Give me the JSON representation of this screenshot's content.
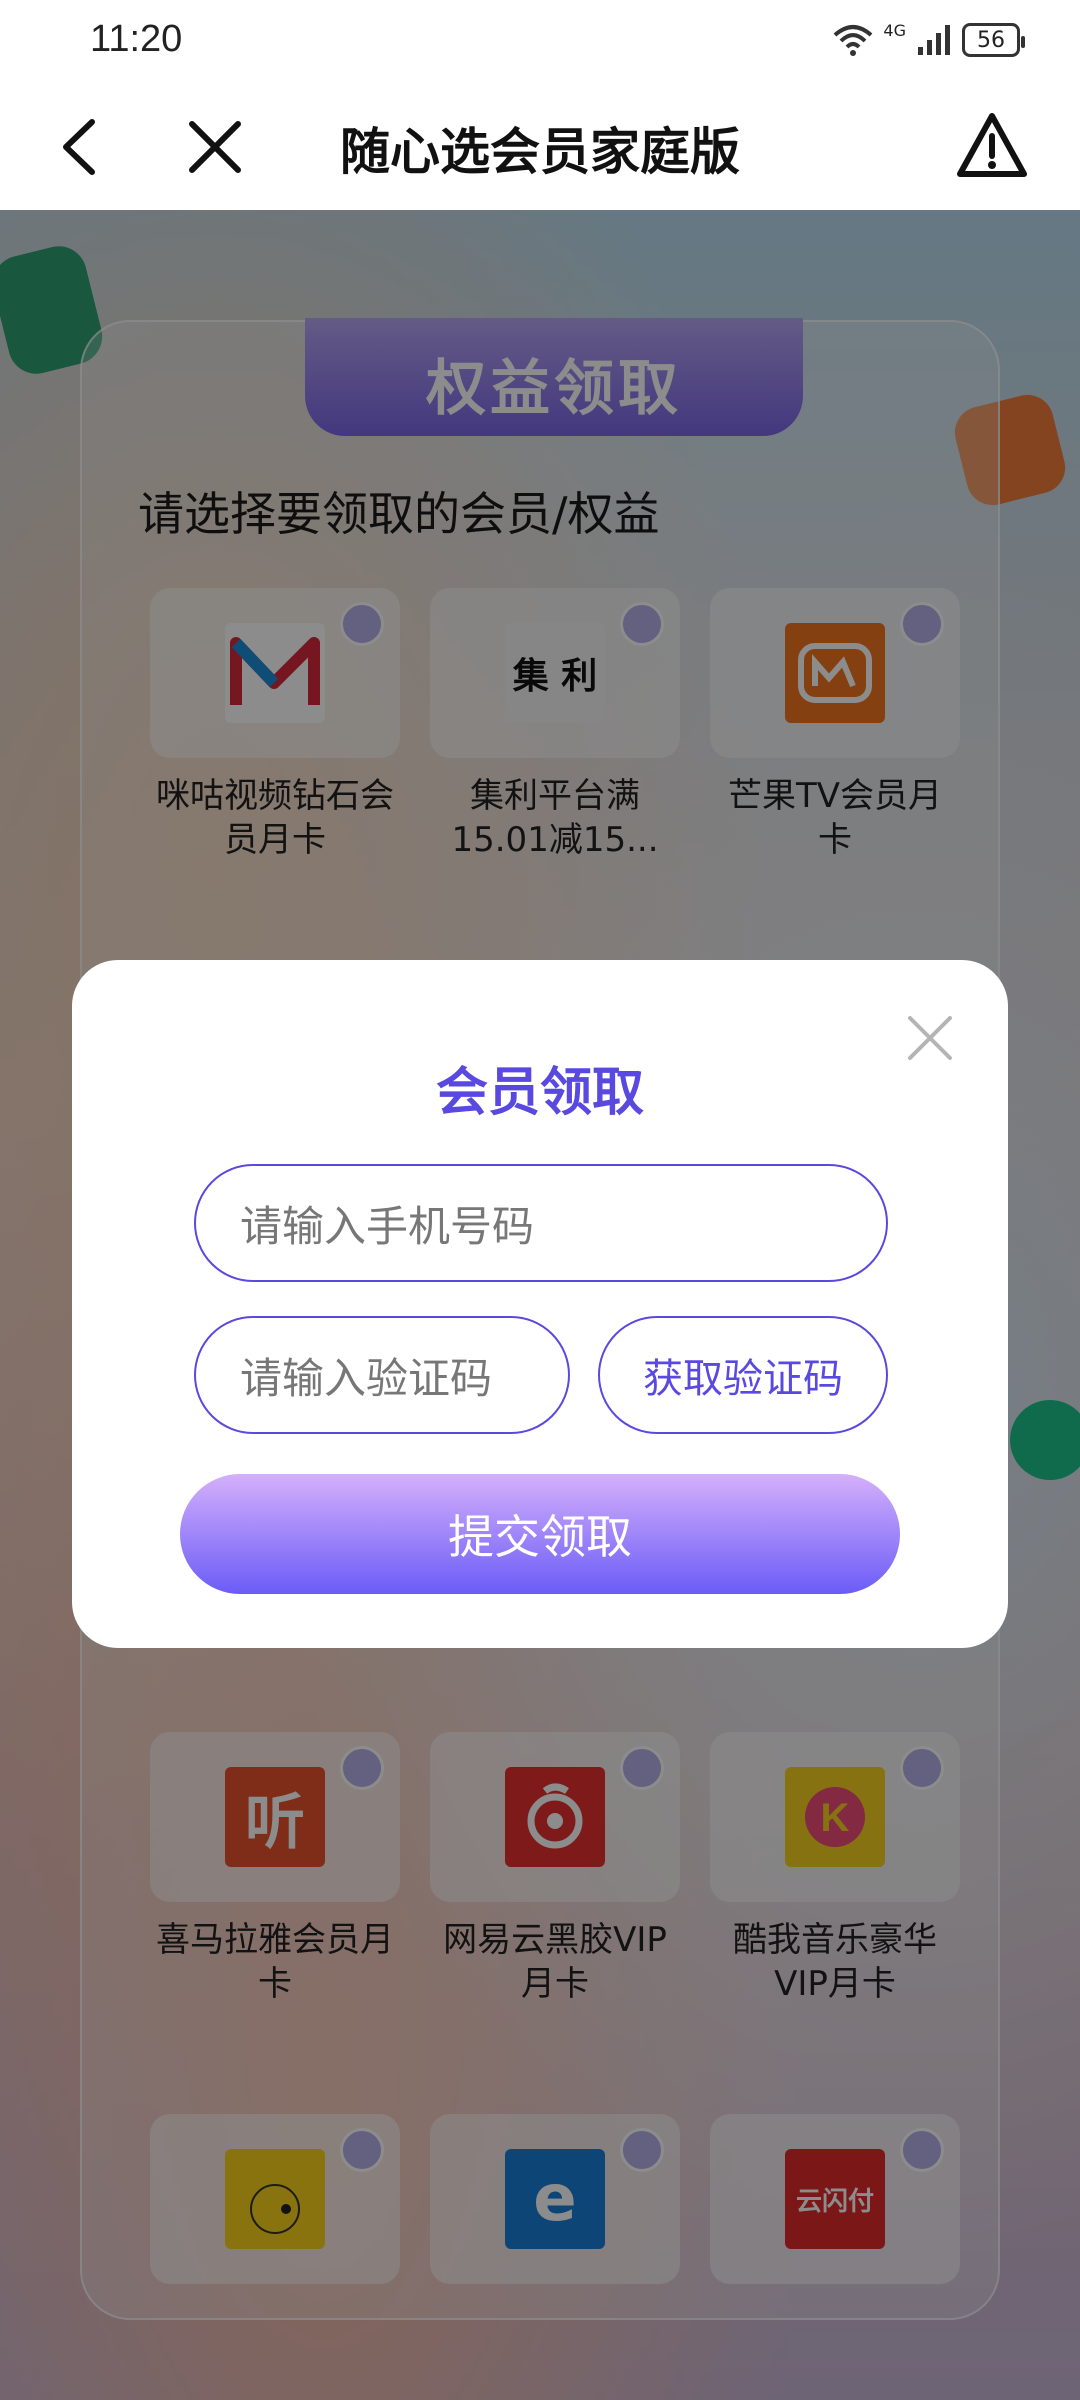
{
  "status_bar": {
    "time": "11:20",
    "network": "4G",
    "battery": "56"
  },
  "nav": {
    "title": "随心选会员家庭版"
  },
  "card": {
    "header": "权益领取",
    "subtitle": "请选择要领取的会员/权益",
    "benefits_row1": [
      {
        "name": "咪咕视频钻石会员月卡",
        "logo_text": "",
        "color": "#ffffff"
      },
      {
        "name": "集利平台满15.01减15...",
        "logo_text": "集 利",
        "color": "#f5f5f5"
      },
      {
        "name": "芒果TV会员月卡",
        "logo_text": "",
        "color": "#f2751f"
      }
    ],
    "benefits_row2": [
      {
        "name": "喜马拉雅会员月卡",
        "logo_text": "听",
        "color": "#e8502f"
      },
      {
        "name": "网易云黑胶VIP月卡",
        "logo_text": "",
        "color": "#e5312f"
      },
      {
        "name": "酷我音乐豪华VIP月卡",
        "logo_text": "K",
        "color": "#f6cf1f"
      }
    ],
    "benefits_row3": [
      {
        "logo_text": "",
        "color": "#f8d21b"
      },
      {
        "logo_text": "e",
        "color": "#1b7fd9"
      },
      {
        "logo_text": "云闪付",
        "color": "#e02b2b"
      }
    ]
  },
  "modal": {
    "title": "会员领取",
    "phone_placeholder": "请输入手机号码",
    "code_placeholder": "请输入验证码",
    "get_code_label": "获取验证码",
    "submit_label": "提交领取"
  },
  "colors": {
    "accent": "#5a49e0",
    "submit_gradient_top": "#d4b0fb",
    "submit_gradient_bottom": "#6b5cf7"
  }
}
